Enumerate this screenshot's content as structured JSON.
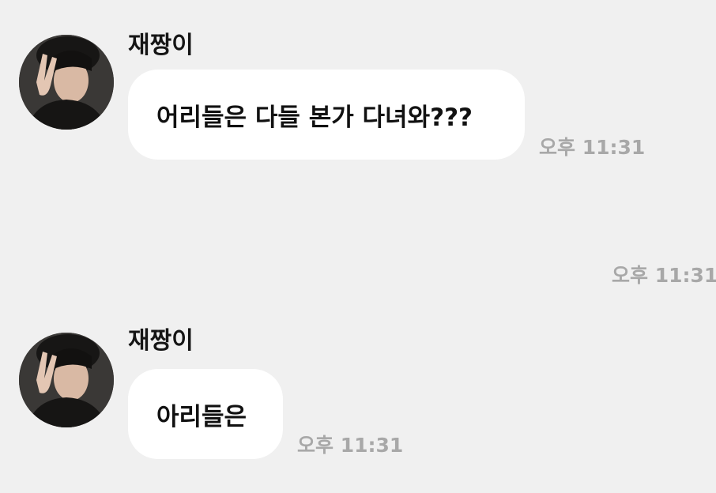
{
  "chat": {
    "messages": [
      {
        "sender": "재짱이",
        "text": "어리들은 다들 본가 다녀와???",
        "time": "오후 11:31",
        "avatar_icon": "profile-photo-peace-sign"
      },
      {
        "time": "오후 11:31"
      },
      {
        "sender": "재짱이",
        "text": "아리들은",
        "time": "오후 11:31",
        "avatar_icon": "profile-photo-peace-sign"
      }
    ]
  }
}
